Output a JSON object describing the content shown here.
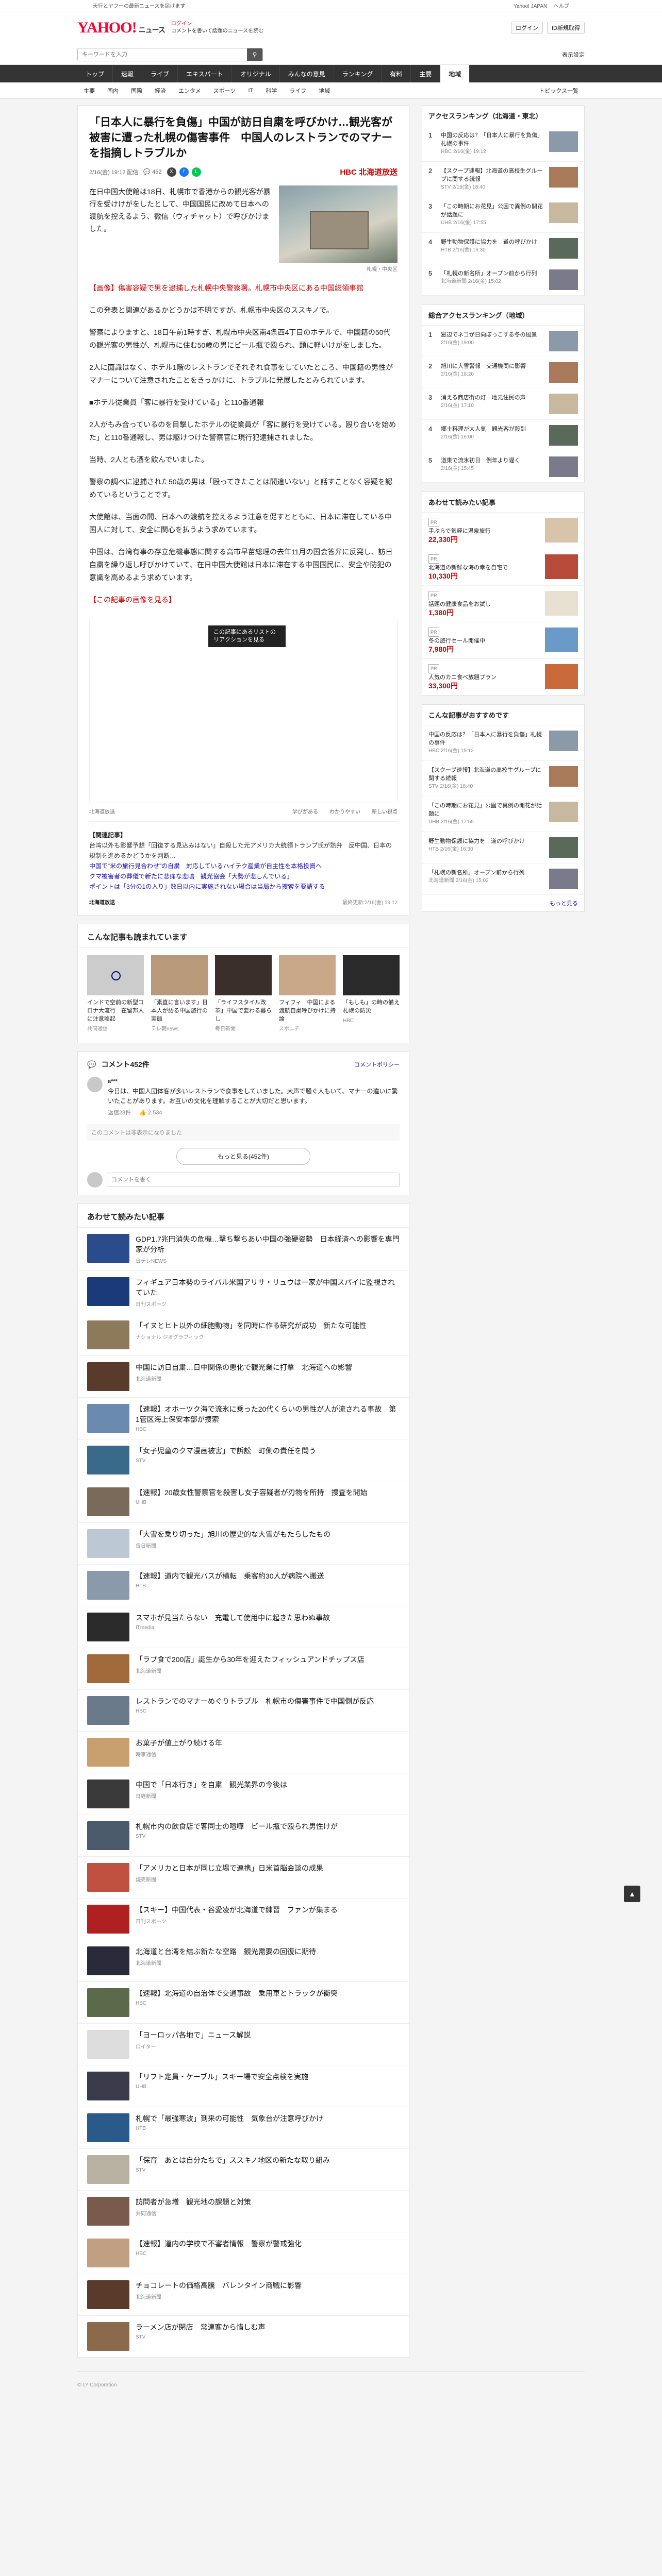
{
  "topbar": {
    "notice": "天行とヤフーの最新ニュースを届けます",
    "links": [
      "Yahoo! JAPAN",
      "ヘルプ"
    ]
  },
  "header": {
    "logo": "YAHOO!",
    "logo_sub": "ニュース",
    "links_line1": "ログイン",
    "links_line2": "コメントを書いて話題のニュースを読む",
    "login_label": "ログイン",
    "register_label": "ID新規取得"
  },
  "search": {
    "placeholder": "キーワードを入力",
    "settings_label": "表示設定"
  },
  "global_nav": [
    "トップ",
    "速報",
    "ライブ",
    "エキスパート",
    "オリジナル",
    "みんなの意見",
    "ランキング",
    "有料",
    "主要",
    "国内",
    "国際",
    "経済",
    "エンタメ",
    "スポーツ",
    "IT",
    "科学",
    "ライフ",
    "地域"
  ],
  "global_nav_active": "地域",
  "sub_nav": {
    "items": [
      "主要",
      "国内",
      "国際",
      "経済",
      "エンタメ",
      "スポーツ",
      "IT",
      "科学",
      "ライフ",
      "地域"
    ],
    "topics": "トピックス一覧"
  },
  "article": {
    "title": "「日本人に暴行を負傷」中国が訪日自粛を呼びかけ…観光客が被害に遭った札幌の傷害事件　中国人のレストランでのマナーを指摘しトラブルか",
    "date": "2/16(金) 19:12 配信",
    "comment_count": "452",
    "publisher": "HBC 北海道放送",
    "lead": "在日中国大使館は18日、札幌市で香港からの観光客が暴行を受けけがをしたとして、中国国民に改めて日本への渡航を控えるよう、微信（ウィチャット）で呼びかけました。",
    "photo_caption": "札幌・中央区",
    "paragraphs": [
      "【画像】傷害容疑で男を逮捕した札幌中央警察署。札幌市中央区にある中国総領事館",
      "この発表と関連があるかどうかは不明ですが、札幌市中央区のススキノで。",
      "警察によりますと、18日午前1時すぎ、札幌市中央区南4条西4丁目のホテルで、中国籍の50代の観光客の男性が、札幌市に住む50歳の男にビール瓶で殴られ、頭に軽いけがをしました。",
      "2人に面識はなく、ホテル1階のレストランでそれぞれ食事をしていたところ、中国籍の男性がマナーについて注意されたことをきっかけに、トラブルに発展したとみられています。",
      "■ホテル従業員「客に暴行を受けている」と110番通報",
      "2人がもみ合っているのを目撃したホテルの従業員が「客に暴行を受けている。殴り合いを始めた」と110番通報し、男は駆けつけた警察官に現行犯逮捕されました。",
      "当時、2人とも酒を飲んでいました。",
      "警察の調べに逮捕された50歳の男は「殴ってきたことは間違いない」と話すことなく容疑を認めているということです。",
      "大使館は、当面の間、日本への渡航を控えるよう注意を促すとともに、日本に滞在している中国人に対して、安全に関心を払うよう求めています。",
      "中国は、台湾有事の存立危機事態に関する高市早苗総理の去年11月の国会答弁に反発し、訪日自粛を繰り返し呼びかけていて、在日中国大使館は日本に滞在する中国国民に、安全や防犯の意識を高めるよう求めています。",
      "【この記事の画像を見る】"
    ],
    "movie_label": "この記事にあるリストのリアクションを見る",
    "reactions": [
      "学びがある",
      "わかりやすい",
      "新しい視点"
    ],
    "reaction_tag": "北海道放送",
    "related_head": "【関連記事】",
    "related_text": "台湾以外も影響予想「回復する見込みはない」自殺した元アメリカ大統領トランプ氏が熱弁　反中国、日本の規制を進めるかどうかを判断…",
    "related_links": [
      "中国で“米の旅行見合わせ”の自粛　対応しているハイテク産業が自主性を本格投資へ",
      "クマ被害者の葬儀で新たに悲痛な悲鳴　観光協会「大勢が悲しんでいる」",
      "ポイントは「3分の1の入り」数日以内に実施されない場合は当局から捜索を要請する"
    ],
    "footer_source": "北海道放送",
    "footer_time": "最終更新:2/16(金) 19:12"
  },
  "read_next": {
    "title": "こんな記事も読まれています",
    "items": [
      {
        "title": "インドで空前の新型コロナ大流行　在留邦人に注意喚起",
        "source": "共同通信"
      },
      {
        "title": "「素直に言います」日本人が語る中国旅行の実態",
        "source": "テレ朝news"
      },
      {
        "title": "「ライフスタイル改革」中国で変わる暮らし",
        "source": "毎日新聞"
      },
      {
        "title": "フィフィ　中国による渡航自粛呼びかけに持論",
        "source": "スポニチ"
      },
      {
        "title": "「もしも」の時の備え　札幌の防災",
        "source": "HBC"
      }
    ]
  },
  "comments": {
    "title": "コメント",
    "count_label": "コメント452件",
    "policy": "コメントポリシー",
    "top_comment": "今日は、中国人団体客が多いレストランで食事をしていました。大声で騒ぐ人もいて、マナーの違いに驚いたことがあります。お互いの文化を理解することが大切だと思います。",
    "top_author": "a***",
    "top_time": "返信28件",
    "likes": "2,534",
    "hidden_notice": "このコメントは非表示になりました",
    "more_button": "もっと見る(452件)",
    "post_placeholder": "コメントを書く"
  },
  "also_read": {
    "title": "あわせて読みたい記事",
    "items": [
      {
        "title": "GDP1.7兆円消失の危機…撃ち撃ちあい中国の強硬姿勢　日本経済への影響を専門家が分析",
        "source": "日テレNEWS",
        "thumb": "#2a4b8c"
      },
      {
        "title": "フィギュア日本勢のライバル米国アリサ・リュウは一家が中国スパイに監視されていた",
        "source": "日刊スポーツ",
        "thumb": "#1a3a7a"
      },
      {
        "title": "「イヌとヒト以外の細胞動物」を同時に作る研究が成功　新たな可能性",
        "source": "ナショナル ジオグラフィック",
        "thumb": "#8c7a5a"
      },
      {
        "title": "中国に訪日自粛…日中関係の悪化で観光業に打撃　北海道への影響",
        "source": "北海道新聞",
        "thumb": "#5a3a2a"
      },
      {
        "title": "【速報】オホーツク海で流氷に乗った20代くらいの男性が人が流される事故　第1管区海上保安本部が捜索",
        "source": "HBC",
        "thumb": "#6a8ab0"
      },
      {
        "title": "「女子児童のクマ漫画被害」で訴訟　町側の責任を問う",
        "source": "STV",
        "thumb": "#3a6a8a"
      },
      {
        "title": "【速報】20歳女性警察官を殺害し女子容疑者が刃物を所持　捜査を開始",
        "source": "UHB",
        "thumb": "#7a6a5a"
      },
      {
        "title": "「大雪を乗り切った」旭川の歴史的な大雪がもたらしたもの",
        "source": "毎日新聞",
        "thumb": "#bcc8d4"
      },
      {
        "title": "【速報】道内で観光バスが横転　乗客約30人が病院へ搬送",
        "source": "HTB",
        "thumb": "#8a9aaa"
      },
      {
        "title": "スマホが見当たらない　充電して使用中に起きた思わぬ事故",
        "source": "ITmedia",
        "thumb": "#2a2a2a"
      },
      {
        "title": "「ラプ食で200店」誕生から30年を迎えたフィッシュアンドチップス店",
        "source": "北海道新聞",
        "thumb": "#a06a3a"
      },
      {
        "title": "レストランでのマナーめぐりトラブル　札幌市の傷害事件で中国側が反応",
        "source": "HBC",
        "thumb": "#6a7a8a"
      },
      {
        "title": "お菓子が値上がり続ける年",
        "source": "時事通信",
        "thumb": "#c8a070"
      },
      {
        "title": "中国で「日本行き」を自粛　観光業界の今後は",
        "source": "日経新聞",
        "thumb": "#3a3a3a"
      },
      {
        "title": "札幌市内の飲食店で客同士の喧嘩　ビール瓶で殴られ男性けが",
        "source": "STV",
        "thumb": "#4a5a6a"
      },
      {
        "title": "「アメリカと日本が同じ立場で連携」日米首脳会談の成果",
        "source": "読売新聞",
        "thumb": "#c05040"
      },
      {
        "title": "【スキー】中国代表・谷愛凌が北海道で練習　ファンが集まる",
        "source": "日刊スポーツ",
        "thumb": "#b02020"
      },
      {
        "title": "北海道と台湾を結ぶ新たな空路　観光需要の回復に期待",
        "source": "北海道新聞",
        "thumb": "#2a2a3a"
      },
      {
        "title": "【速報】北海道の自治体で交通事故　乗用車とトラックが衝突",
        "source": "HBC",
        "thumb": "#5a6a4a"
      },
      {
        "title": "「ヨーロッパ各地で」ニュース解説",
        "source": "ロイター",
        "thumb": "#ddd"
      },
      {
        "title": "「リフト定員・ケーブル」スキー場で安全点検を実施",
        "source": "UHB",
        "thumb": "#3a3a4a"
      },
      {
        "title": "札幌で「最強寒波」到来の可能性　気象台が注意呼びかけ",
        "source": "HTB",
        "thumb": "#2a5a8a"
      },
      {
        "title": "「保育　あとは自分たちで」ススキノ地区の新たな取り組み",
        "source": "STV",
        "thumb": "#b8b0a0"
      },
      {
        "title": "訪問者が急増　観光地の課題と対策",
        "source": "共同通信",
        "thumb": "#7a5a4a"
      },
      {
        "title": "【速報】道内の学校で不審者情報　警察が警戒強化",
        "source": "HBC",
        "thumb": "#c0a080"
      },
      {
        "title": "チョコレートの価格高騰　バレンタイン商戦に影響",
        "source": "北海道新聞",
        "thumb": "#5a3a2a"
      },
      {
        "title": "ラーメン店が閉店　常連客から惜しむ声",
        "source": "STV",
        "thumb": "#8a6a4a"
      }
    ]
  },
  "side": {
    "ranking_title": "アクセスランキング（北海道・東北）",
    "ranking": [
      {
        "title": "中国の反応は？「日本人に暴行を負傷」札幌の事件",
        "source": "HBC 2/16(金) 19:12"
      },
      {
        "title": "【スクープ速報】北海道の高校生グループに関する続報",
        "source": "STV 2/16(金) 18:40"
      },
      {
        "title": "「この時期にお花見」公園で異例の開花が話題に",
        "source": "UHB 2/16(金) 17:55"
      },
      {
        "title": "野生動物保護に協力を　道の呼びかけ",
        "source": "HTB 2/16(金) 16:30"
      },
      {
        "title": "「札幌の新名所」オープン前から行列",
        "source": "北海道新聞 2/16(金) 15:02"
      }
    ],
    "ranking2_title": "総合アクセスランキング（地域）",
    "ranking2": [
      {
        "title": "窓辺でネコが日向ぼっこする冬の風景",
        "source": "2/16(金) 19:00"
      },
      {
        "title": "旭川に大雪警報　交通機関に影響",
        "source": "2/16(金) 18:20"
      },
      {
        "title": "消える商店街の灯　地元住民の声",
        "source": "2/16(金) 17:10"
      },
      {
        "title": "郷土料理が大人気　観光客が殺到",
        "source": "2/16(金) 16:00"
      },
      {
        "title": "道東で流氷初日　例年より遅く",
        "source": "2/16(金) 15:45"
      }
    ],
    "ads_title": "あわせて読みたい記事",
    "ads": [
      {
        "title": "手ぶらで気軽に温泉旅行",
        "price": "22,330円"
      },
      {
        "title": "北海道の新鮮な海の幸を自宅で",
        "price": "10,330円"
      },
      {
        "title": "話題の健康食品をお試し",
        "price": "1,380円"
      },
      {
        "title": "冬の旅行セール開催中",
        "price": "7,980円"
      },
      {
        "title": "人気のカニ食べ放題プラン",
        "price": "33,300円"
      }
    ],
    "recommend_title": "こんな記事がおすすめです",
    "see_more": "もっと見る"
  },
  "page_top": "▲",
  "footer": "© LY Corporation"
}
